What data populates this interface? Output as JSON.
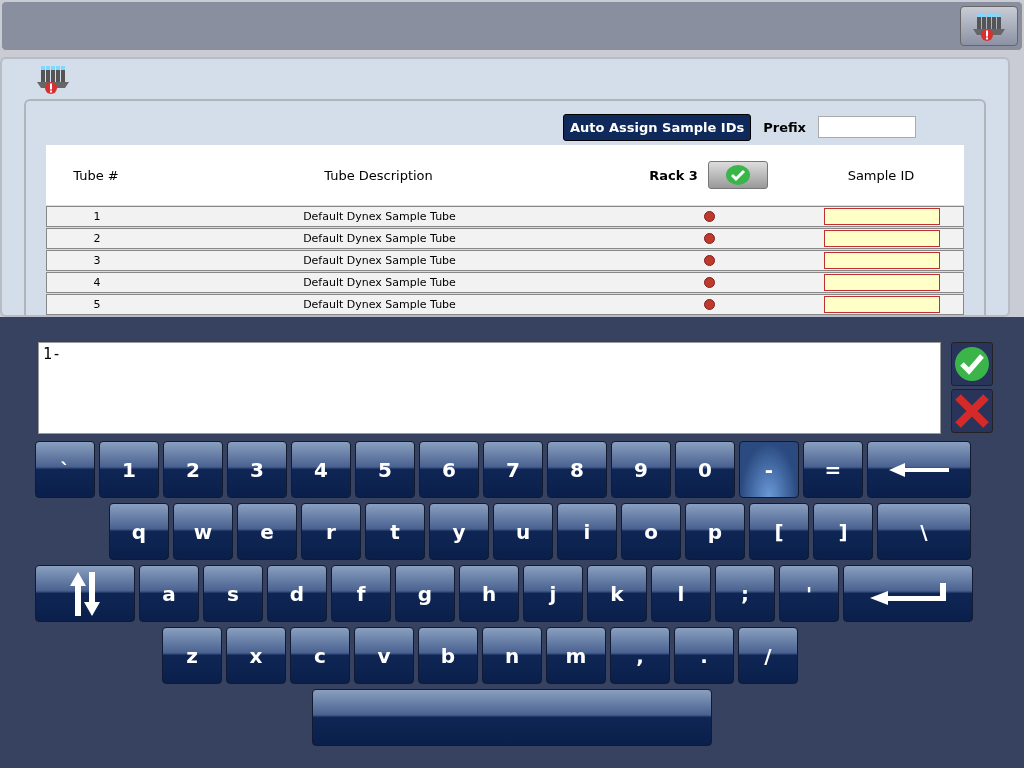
{
  "toolbar": {
    "has_alert": true
  },
  "panel": {
    "has_alert": true
  },
  "auto_assign_button": "Auto Assign Sample IDs",
  "prefix": {
    "label": "Prefix"
  },
  "table": {
    "columns": [
      "Tube #",
      "Tube Description",
      "Rack 3",
      "Sample ID"
    ],
    "rows": [
      {
        "tube": "1",
        "description": "Default Dynex Sample Tube",
        "assigned": false
      },
      {
        "tube": "2",
        "description": "Default Dynex Sample Tube",
        "assigned": false
      },
      {
        "tube": "3",
        "description": "Default Dynex Sample Tube",
        "assigned": false
      },
      {
        "tube": "4",
        "description": "Default Dynex Sample Tube",
        "assigned": false
      },
      {
        "tube": "5",
        "description": "Default Dynex Sample Tube",
        "assigned": false
      }
    ]
  },
  "keyboard": {
    "input": "1-",
    "rows": [
      [
        {
          "kind": "char",
          "label": "`",
          "pressed": false
        },
        {
          "kind": "char",
          "label": "1",
          "pressed": false
        },
        {
          "kind": "char",
          "label": "2",
          "pressed": false
        },
        {
          "kind": "char",
          "label": "3",
          "pressed": false
        },
        {
          "kind": "char",
          "label": "4",
          "pressed": false
        },
        {
          "kind": "char",
          "label": "5",
          "pressed": false
        },
        {
          "kind": "char",
          "label": "6",
          "pressed": false
        },
        {
          "kind": "char",
          "label": "7",
          "pressed": false
        },
        {
          "kind": "char",
          "label": "8",
          "pressed": false
        },
        {
          "kind": "char",
          "label": "9",
          "pressed": false
        },
        {
          "kind": "char",
          "label": "0",
          "pressed": false
        },
        {
          "kind": "char",
          "label": "-",
          "pressed": true
        },
        {
          "kind": "char",
          "label": "=",
          "pressed": false
        },
        {
          "kind": "backspace",
          "pressed": false
        }
      ],
      [
        {
          "kind": "char",
          "label": "q",
          "pressed": false
        },
        {
          "kind": "char",
          "label": "w",
          "pressed": false
        },
        {
          "kind": "char",
          "label": "e",
          "pressed": false
        },
        {
          "kind": "char",
          "label": "r",
          "pressed": false
        },
        {
          "kind": "char",
          "label": "t",
          "pressed": false
        },
        {
          "kind": "char",
          "label": "y",
          "pressed": false
        },
        {
          "kind": "char",
          "label": "u",
          "pressed": false
        },
        {
          "kind": "char",
          "label": "i",
          "pressed": false
        },
        {
          "kind": "char",
          "label": "o",
          "pressed": false
        },
        {
          "kind": "char",
          "label": "p",
          "pressed": false
        },
        {
          "kind": "char",
          "label": "[",
          "pressed": false
        },
        {
          "kind": "char",
          "label": "]",
          "pressed": false
        },
        {
          "kind": "wide",
          "label": "\\",
          "pressed": false
        }
      ],
      [
        {
          "kind": "shift",
          "pressed": false
        },
        {
          "kind": "char",
          "label": "a",
          "pressed": false
        },
        {
          "kind": "char",
          "label": "s",
          "pressed": false
        },
        {
          "kind": "char",
          "label": "d",
          "pressed": false
        },
        {
          "kind": "char",
          "label": "f",
          "pressed": false
        },
        {
          "kind": "char",
          "label": "g",
          "pressed": false
        },
        {
          "kind": "char",
          "label": "h",
          "pressed": false
        },
        {
          "kind": "char",
          "label": "j",
          "pressed": false
        },
        {
          "kind": "char",
          "label": "k",
          "pressed": false
        },
        {
          "kind": "char",
          "label": "l",
          "pressed": false
        },
        {
          "kind": "char",
          "label": ";",
          "pressed": false
        },
        {
          "kind": "char",
          "label": "'",
          "pressed": false
        },
        {
          "kind": "enter",
          "pressed": false
        }
      ],
      [
        {
          "kind": "char",
          "label": "z",
          "pressed": false
        },
        {
          "kind": "char",
          "label": "x",
          "pressed": false
        },
        {
          "kind": "char",
          "label": "c",
          "pressed": false
        },
        {
          "kind": "char",
          "label": "v",
          "pressed": false
        },
        {
          "kind": "char",
          "label": "b",
          "pressed": false
        },
        {
          "kind": "char",
          "label": "n",
          "pressed": false
        },
        {
          "kind": "char",
          "label": "m",
          "pressed": false
        },
        {
          "kind": "char",
          "label": ",",
          "pressed": false
        },
        {
          "kind": "char",
          "label": ".",
          "pressed": false
        },
        {
          "kind": "char",
          "label": "/",
          "pressed": false
        }
      ],
      [
        {
          "kind": "space",
          "pressed": false
        }
      ]
    ]
  }
}
